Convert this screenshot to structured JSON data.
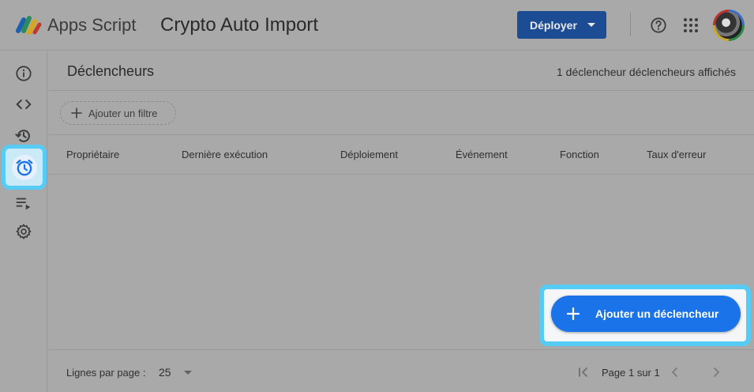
{
  "header": {
    "brand": "Apps Script",
    "project_title": "Crypto Auto Import",
    "deploy_label": "Déployer"
  },
  "rail": {
    "items": [
      "info-icon",
      "code-icon",
      "history-icon",
      "alarm-icon",
      "executions-icon",
      "gear-icon"
    ],
    "active": "alarm-icon"
  },
  "main": {
    "title": "Déclencheurs",
    "count_text": "1 déclencheur déclencheurs affichés",
    "filter_label": "Ajouter un filtre",
    "columns": [
      "Propriétaire",
      "Dernière exécution",
      "Déploiement",
      "Événement",
      "Fonction",
      "Taux d'erreur"
    ],
    "add_trigger_label": "Ajouter un déclencheur"
  },
  "footer": {
    "rows_label": "Lignes par page :",
    "rows_value": "25",
    "page_info": "Page 1 sur 1"
  },
  "colors": {
    "accent": "#1a73e8",
    "deploy": "#1c4c93",
    "highlight": "#56cbf4"
  }
}
